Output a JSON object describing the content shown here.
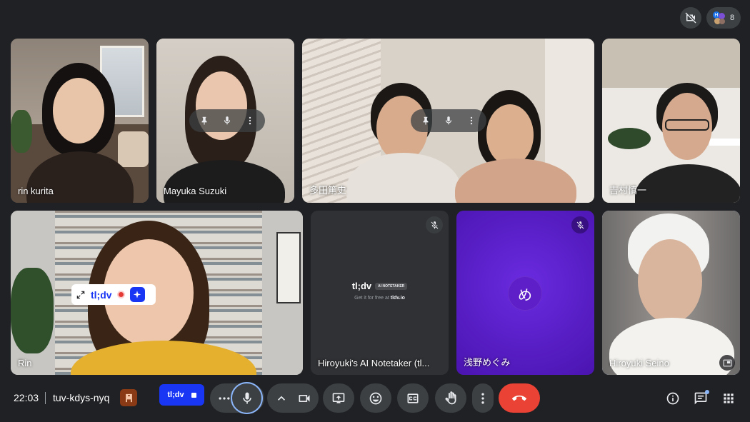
{
  "meeting": {
    "time": "22:03",
    "code": "tuv-kdys-nyq"
  },
  "top_right": {
    "participant_count": "8",
    "avatar_letter": "H"
  },
  "participants": [
    {
      "name": "rin kurita"
    },
    {
      "name": "Mayuka Suzuki"
    },
    {
      "name": "多田篤史"
    },
    {
      "name": "吉村慎一"
    },
    {
      "name": "Rin"
    },
    {
      "name": "Hiroyuki's AI Notetaker (tl..."
    },
    {
      "name": "浅野めぐみ",
      "avatar_letter": "め"
    },
    {
      "name": "Hiroyuki Seino"
    }
  ],
  "notetaker": {
    "brand": "tl;dv",
    "badge": "AI NOTETAKER",
    "tagline": "Get it for free at",
    "link": "tldv.io"
  },
  "tldv_overlay": {
    "label": "tl;dv"
  },
  "tldv_record": {
    "label": "tl;dv"
  },
  "colors": {
    "background": "#202124",
    "accent": "#8ab4f8",
    "end_call": "#ea4335",
    "tldv_blue": "#1a36f5",
    "purple_tile": "#5b1fcc"
  },
  "icons": [
    "pin-icon",
    "mic-icon",
    "more-vert-icon",
    "mic-off-icon",
    "camera-off-icon",
    "expand-icon",
    "record-dot-icon",
    "sparkle-icon",
    "people-icon",
    "more-horiz-icon",
    "chevron-up-icon",
    "camera-icon",
    "present-icon",
    "emoji-icon",
    "captions-icon",
    "hand-icon",
    "hangup-icon",
    "info-icon",
    "chat-icon",
    "apps-icon",
    "pip-icon",
    "host-controls-icon",
    "stop-icon"
  ]
}
